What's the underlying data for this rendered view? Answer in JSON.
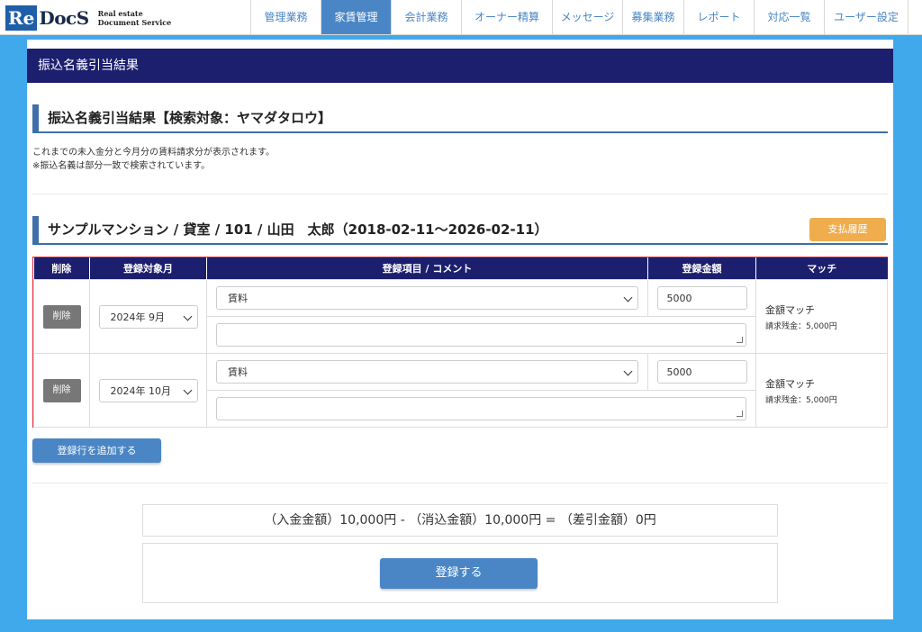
{
  "brand": {
    "logo_re": "Re",
    "logo_docs": "DocS",
    "tagline_line1": "Real estate",
    "tagline_line2": "Document Service"
  },
  "nav": {
    "items": [
      {
        "label": "管理業務"
      },
      {
        "label": "家賃管理",
        "active": true
      },
      {
        "label": "会計業務"
      },
      {
        "label": "オーナー精算"
      },
      {
        "label": "メッセージ"
      },
      {
        "label": "募集業務"
      },
      {
        "label": "レポート"
      },
      {
        "label": "対応一覧"
      },
      {
        "label": "ユーザー設定"
      }
    ]
  },
  "page": {
    "header": "振込名義引当結果",
    "section_title": "振込名義引当結果【検索対象：ヤマダタロウ】",
    "description_line1": "これまでの未入金分と今月分の賃料請求分が表示されます。",
    "description_line2": "※振込名義は部分一致で検索されています。"
  },
  "contract": {
    "title": "サンプルマンション / 貸室 / 101 / 山田　太郎（2018-02-11〜2026-02-11）",
    "history_button": "支払履歴"
  },
  "table": {
    "headers": {
      "delete": "削除",
      "month": "登録対象月",
      "item": "登録項目 / コメント",
      "amount": "登録金額",
      "match": "マッチ"
    },
    "rows": [
      {
        "delete_label": "削除",
        "month": "2024年 9月",
        "item": "賃料",
        "amount": "5000",
        "comment": "",
        "match_title": "金額マッチ",
        "match_detail": "請求残金：5,000円"
      },
      {
        "delete_label": "削除",
        "month": "2024年 10月",
        "item": "賃料",
        "amount": "5000",
        "comment": "",
        "match_title": "金額マッチ",
        "match_detail": "請求残金：5,000円"
      }
    ]
  },
  "actions": {
    "add_row": "登録行を追加する",
    "submit": "登録する"
  },
  "summary": {
    "text": "（入金金額）10,000円 - （消込金額）10,000円 = （差引金額）0円"
  },
  "colors": {
    "page_background": "#3fa9ec",
    "header_navy": "#1c1f6e",
    "primary_blue": "#4a86c5",
    "warning_orange": "#f0ad4e",
    "highlight_red": "#e0293a"
  }
}
